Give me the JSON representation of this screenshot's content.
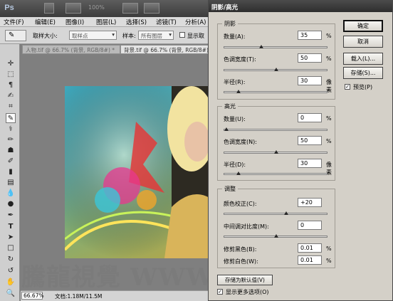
{
  "app": {
    "logo": "Ps",
    "zoom_text": "100%",
    "menu": [
      "文件(F)",
      "编辑(E)",
      "图像(I)",
      "图层(L)",
      "选择(S)",
      "滤镜(T)",
      "分析(A)"
    ],
    "options": {
      "sample_size_label": "取样大小:",
      "sample_size_value": "取样点",
      "sample_label": "样本:",
      "sample_value": "所有图层",
      "show_ring_label": "显示取"
    },
    "tabs": {
      "inactive": "人物.tif @ 66.7% (背景, RGB/8#) *",
      "active": "背景.tif @ 66.7% (背景, RGB/8#)"
    },
    "status": {
      "zoom": "66.67%",
      "doc_info": "文档:1.18M/11.5M"
    },
    "watermark": "騰龍視覺 WWW.TLVI.NET"
  },
  "dialog": {
    "title": "阴影/高光",
    "shadows": {
      "label": "阴影",
      "amount_label": "数量(A):",
      "amount_value": "35",
      "amount_unit": "%",
      "amount_pct": 35,
      "tonal_label": "色调宽度(T):",
      "tonal_value": "50",
      "tonal_unit": "%",
      "tonal_pct": 50,
      "radius_label": "半径(R):",
      "radius_value": "30",
      "radius_unit": "像素",
      "radius_pct": 12
    },
    "highlights": {
      "label": "高光",
      "amount_label": "数量(U):",
      "amount_value": "0",
      "amount_unit": "%",
      "amount_pct": 0,
      "tonal_label": "色调宽度(N):",
      "tonal_value": "50",
      "tonal_unit": "%",
      "tonal_pct": 50,
      "radius_label": "半径(D):",
      "radius_value": "30",
      "radius_unit": "像素",
      "radius_pct": 12
    },
    "adjustments": {
      "label": "调整",
      "color_label": "颜色校正(C):",
      "color_value": "+20",
      "color_pct": 60,
      "midtone_label": "中间调对比度(M):",
      "midtone_value": "0",
      "midtone_pct": 50,
      "black_label": "修剪黑色(B):",
      "black_value": "0.01",
      "black_unit": "%",
      "white_label": "修剪白色(W):",
      "white_value": "0.01",
      "white_unit": "%"
    },
    "buttons": {
      "ok": "确定",
      "cancel": "取消",
      "load": "载入(L)...",
      "save": "存储(S)..."
    },
    "preview_label": "预览(P)",
    "preview_checked": true,
    "save_default": "存储为默认值(V)",
    "more_options_label": "显示更多选项(O)",
    "more_options_checked": true
  }
}
